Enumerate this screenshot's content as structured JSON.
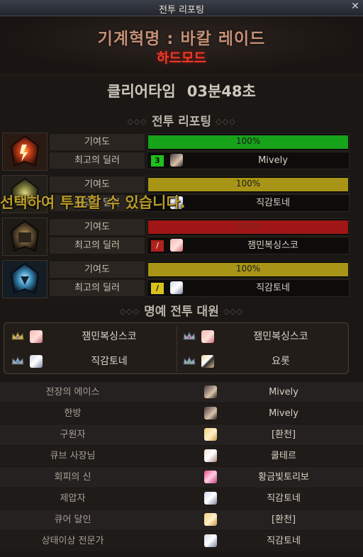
{
  "window": {
    "title": "전투 리포팅",
    "close_icon": "close-icon"
  },
  "raid": {
    "name": "기계혁명 : 바칼 레이드",
    "mode": "하드모드"
  },
  "clear_time": {
    "label": "클리어타임",
    "value": "03분48초"
  },
  "section_report": {
    "title": "전투 리포팅",
    "decor": "◇◇◇"
  },
  "overlay_message": "선택하여 투표할 수 있습니다.",
  "bosses": [
    {
      "icon": "fire-dragon-icon",
      "contribution_label": "기여도",
      "contribution": "100%",
      "bar_color": "#17a31a",
      "dealer_label": "최고의 딜러",
      "badge": "3",
      "badge_color": "#1fc01c",
      "dealer": "Mively"
    },
    {
      "icon": "earth-dragon-icon",
      "contribution_label": "기여도",
      "contribution": "100%",
      "bar_color": "#a89416",
      "dealer_label": "최고의 딜러",
      "badge": "",
      "badge_color": "#b9a41c",
      "dealer": "직감토네"
    },
    {
      "icon": "dark-dragon-icon",
      "contribution_label": "기여도",
      "contribution": "100%",
      "bar_color": "#a01616",
      "dealer_label": "최고의 딜러",
      "badge": "/",
      "badge_color": "#b0201c",
      "dealer": "잼민복싱스코"
    },
    {
      "icon": "ice-dragon-icon",
      "contribution_label": "기여도",
      "contribution": "100%",
      "bar_color": "#a89416",
      "dealer_label": "최고의 딜러",
      "badge": "/",
      "badge_color": "#d9c21c",
      "dealer": "직감토네"
    }
  ],
  "section_honor": {
    "title": "명예 전투 대원",
    "decor": "◇◇◇"
  },
  "honor_members": [
    "잼민복싱스코",
    "잼민복싱스코",
    "직감토네",
    "요롯"
  ],
  "awards": [
    {
      "label": "전장의 에이스",
      "name": "Mively"
    },
    {
      "label": "한방",
      "name": "Mively"
    },
    {
      "label": "구원자",
      "name": "[환천]"
    },
    {
      "label": "큐브 사장님",
      "name": "쿨테르"
    },
    {
      "label": "회피의 신",
      "name": "황금빛토리보"
    },
    {
      "label": "제압자",
      "name": "직감토네"
    },
    {
      "label": "큐어 달인",
      "name": "[환천]"
    },
    {
      "label": "상태이상 전문가",
      "name": "직감토네"
    }
  ]
}
